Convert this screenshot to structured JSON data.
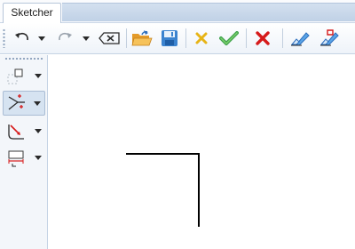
{
  "tab": {
    "label": "Sketcher"
  },
  "toolbar": {
    "buttons": [
      {
        "name": "undo",
        "icon": "undo-icon"
      },
      {
        "name": "undo-dropdown",
        "icon": "chevron-down-icon"
      },
      {
        "name": "redo",
        "icon": "redo-icon"
      },
      {
        "name": "redo-dropdown",
        "icon": "chevron-down-icon"
      },
      {
        "name": "delete",
        "icon": "backspace-icon"
      },
      {
        "name": "open",
        "icon": "folder-open-icon"
      },
      {
        "name": "save",
        "icon": "floppy-disk-icon"
      },
      {
        "name": "cancel-yellow",
        "icon": "yellow-x-icon"
      },
      {
        "name": "accept",
        "icon": "green-check-icon"
      },
      {
        "name": "close",
        "icon": "red-x-icon"
      },
      {
        "name": "eraser",
        "icon": "eraser-icon"
      },
      {
        "name": "eraser-red",
        "icon": "eraser-red-icon"
      }
    ]
  },
  "sidebar": {
    "tools": [
      {
        "name": "sketch-rectangle-tool",
        "icon": "rectangle-dashed-icon",
        "active": false
      },
      {
        "name": "trim-tool",
        "icon": "line-points-icon",
        "active": true
      },
      {
        "name": "fillet-tool",
        "icon": "fillet-corner-icon",
        "active": false
      },
      {
        "name": "dimension-tool",
        "icon": "dimension-icon",
        "active": false
      }
    ]
  },
  "colors": {
    "accent": "#2c6ebd",
    "green": "#3fa34d",
    "red": "#d61a1a",
    "yellow": "#e7b416",
    "sketch_line": "#000000"
  }
}
